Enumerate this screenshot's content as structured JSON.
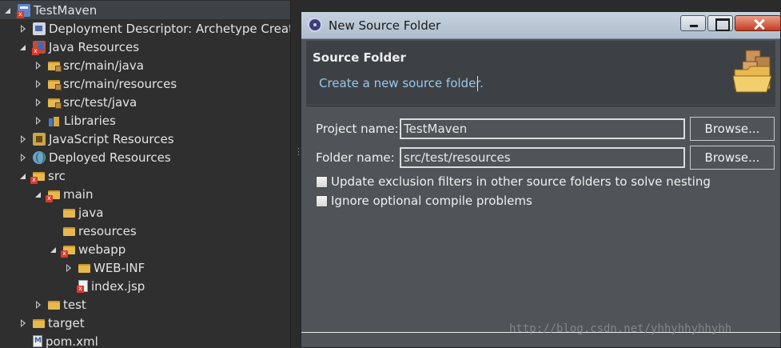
{
  "explorer": {
    "items": [
      {
        "label": "TestMaven",
        "state": "expanded",
        "icon": "project-icon"
      },
      {
        "label": "Deployment Descriptor: Archetype Created Web Application",
        "state": "collapsed",
        "icon": "deployment-descriptor-icon"
      },
      {
        "label": "Java Resources",
        "state": "expanded",
        "icon": "java-resources-icon"
      },
      {
        "label": "src/main/java",
        "state": "collapsed",
        "icon": "package-folder-icon"
      },
      {
        "label": "src/main/resources",
        "state": "collapsed",
        "icon": "package-folder-icon"
      },
      {
        "label": "src/test/java",
        "state": "collapsed",
        "icon": "package-folder-icon"
      },
      {
        "label": "Libraries",
        "state": "collapsed",
        "icon": "libraries-icon"
      },
      {
        "label": "JavaScript Resources",
        "state": "collapsed",
        "icon": "javascript-resources-icon"
      },
      {
        "label": "Deployed Resources",
        "state": "collapsed",
        "icon": "deployed-resources-icon"
      },
      {
        "label": "src",
        "state": "expanded",
        "icon": "folder-error-icon"
      },
      {
        "label": "main",
        "state": "expanded",
        "icon": "folder-error-icon"
      },
      {
        "label": "java",
        "state": "none",
        "icon": "folder-icon"
      },
      {
        "label": "resources",
        "state": "none",
        "icon": "folder-icon"
      },
      {
        "label": "webapp",
        "state": "expanded",
        "icon": "folder-error-icon"
      },
      {
        "label": "WEB-INF",
        "state": "collapsed",
        "icon": "folder-icon"
      },
      {
        "label": "index.jsp",
        "state": "none",
        "icon": "jsp-file-error-icon"
      },
      {
        "label": "test",
        "state": "collapsed",
        "icon": "folder-icon"
      },
      {
        "label": "target",
        "state": "collapsed",
        "icon": "folder-icon"
      },
      {
        "label": "pom.xml",
        "state": "none",
        "icon": "maven-pom-icon"
      }
    ]
  },
  "dialog": {
    "title": "New Source Folder",
    "heading": "Source Folder",
    "description": "Create a new source folder.",
    "project_label": "Project name:",
    "project_value": "TestMaven",
    "folder_label": "Folder name:",
    "folder_value": "src/test/resources",
    "browse_label": "Browse...",
    "checkbox_update": "Update exclusion filters in other source folders to solve nesting",
    "checkbox_ignore": "Ignore optional compile problems",
    "update_checked": false,
    "ignore_checked": false
  },
  "watermark": "http://blog.csdn.net/yhhyhhyhhyhh",
  "colors": {
    "tree_background": "#2f2f2f",
    "dialog_background": "#505458",
    "banner_background": "#3d4146",
    "description_text": "#9ac7e8",
    "close_button": "#c43b1f"
  }
}
